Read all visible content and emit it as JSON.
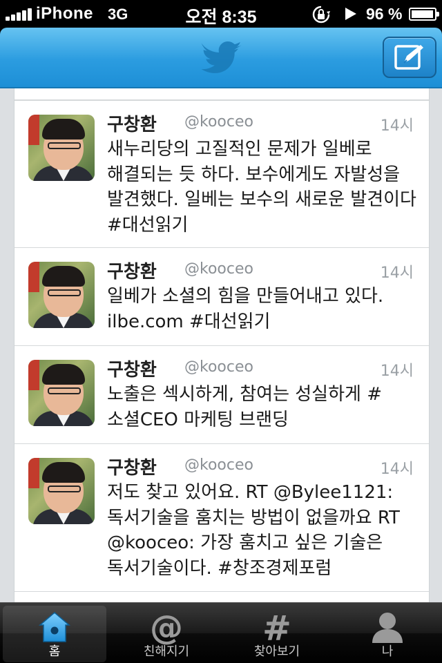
{
  "status_bar": {
    "carrier": "iPhone",
    "network": "3G",
    "time": "오전 8:35",
    "battery_text": "96 %",
    "battery_level": 0.96
  },
  "nav": {
    "logo_icon": "twitter-bird-icon",
    "compose_icon": "compose-icon",
    "bar_color": "#2b9ce0"
  },
  "tweets": [
    {
      "name": "구창환",
      "handle": "@kooceo",
      "time": "14시",
      "text": "새누리당의 고질적인 문제가 일베로 해결되는 듯 하다. 보수에게도 자발성을 발견했다.  일베는 보수의 새로운 발견이다 #대선읽기"
    },
    {
      "name": "구창환",
      "handle": "@kooceo",
      "time": "14시",
      "text": "일베가 소셜의 힘을 만들어내고 있다. ilbe.com #대선읽기"
    },
    {
      "name": "구창환",
      "handle": "@kooceo",
      "time": "14시",
      "text": "노출은 섹시하게, 참여는 성실하게 #소셜CEO 마케팅 브랜딩"
    },
    {
      "name": "구창환",
      "handle": "@kooceo",
      "time": "14시",
      "text": "저도 찾고 있어요. RT @Bylee1121: 독서기술을 훔치는 방법이 없을까요 RT @kooceo: 가장 훔치고 싶은 기술은 독서기술이다. #창조경제포럼"
    }
  ],
  "tabs": [
    {
      "label": "홈",
      "icon": "home-icon",
      "selected": true
    },
    {
      "label": "친해지기",
      "icon": "at-sign-icon",
      "selected": false
    },
    {
      "label": "찾아보기",
      "icon": "hashtag-icon",
      "selected": false
    },
    {
      "label": "나",
      "icon": "person-icon",
      "selected": false
    }
  ]
}
